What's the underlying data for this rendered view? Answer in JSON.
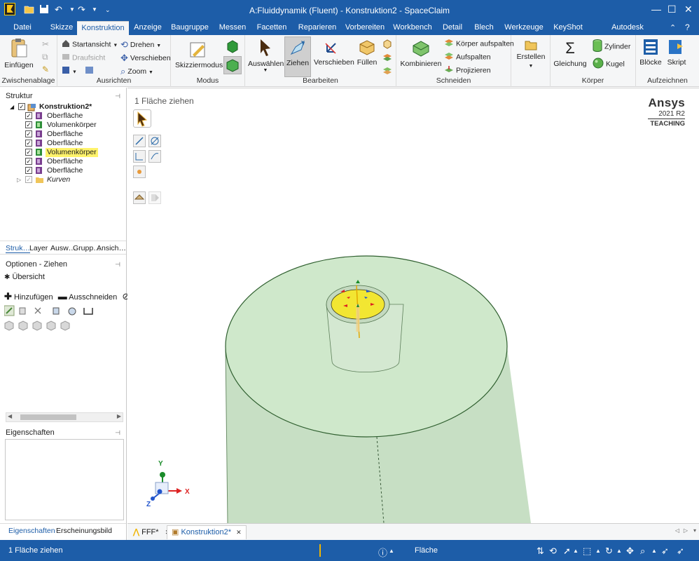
{
  "window": {
    "title": "A:Fluiddynamik (Fluent) - Konstruktion2 - SpaceClaim"
  },
  "quick_access": {
    "icons": [
      "app-logo-icon",
      "open-folder-icon",
      "save-icon",
      "undo-icon",
      "redo-icon",
      "customize-icon"
    ]
  },
  "tabs": [
    "Datei",
    "Skizze",
    "Konstruktion",
    "Anzeige",
    "Baugruppe",
    "Messen",
    "Facetten",
    "Reparieren",
    "Vorbereiten",
    "Workbench",
    "Detail",
    "Blech",
    "Werkzeuge",
    "KeyShot",
    "Autodesk Simulation"
  ],
  "active_tab": "Konstruktion",
  "ribbon": {
    "groups": {
      "zwischenablage": "Zwischenablage",
      "ausrichten": "Ausrichten",
      "modus": "Modus",
      "bearbeiten": "Bearbeiten",
      "schneiden": "Schneiden",
      "koerper": "Körper",
      "aufzeichnen": "Aufzeichnen"
    },
    "buttons": {
      "einfuegen": "Einfügen",
      "startansicht": "Startansicht",
      "draufsicht": "Draufsicht",
      "drehen": "Drehen",
      "verschieben_view": "Verschieben",
      "zoom": "Zoom",
      "skizziermodus": "Skizziermodus",
      "auswaehlen": "Auswählen",
      "ziehen": "Ziehen",
      "verschieben": "Verschieben",
      "fuellen": "Füllen",
      "kombinieren": "Kombinieren",
      "koerper_aufspalten": "Körper aufspalten",
      "aufspalten": "Aufspalten",
      "projizieren": "Projizieren",
      "erstellen": "Erstellen",
      "gleichung": "Gleichung",
      "zylinder": "Zylinder",
      "kugel": "Kugel",
      "bloecke": "Blöcke",
      "skript": "Skript"
    }
  },
  "structure": {
    "title": "Struktur",
    "root": "Konstruktion2*",
    "items": [
      {
        "label": "Oberfläche",
        "type": "surface"
      },
      {
        "label": "Volumenkörper",
        "type": "solid"
      },
      {
        "label": "Oberfläche",
        "type": "surface"
      },
      {
        "label": "Oberfläche",
        "type": "surface"
      },
      {
        "label": "Volumenkörper",
        "type": "solid",
        "highlighted": true
      },
      {
        "label": "Oberfläche",
        "type": "surface"
      },
      {
        "label": "Oberfläche",
        "type": "surface"
      }
    ],
    "curves": "Kurven",
    "tabs": [
      "Struk…",
      "Layer",
      "Ausw…",
      "Grupp…",
      "Ansich…"
    ]
  },
  "options": {
    "title": "Optionen - Ziehen",
    "overview": "Übersicht",
    "add": "Hinzufügen",
    "cut": "Ausschneiden"
  },
  "properties": {
    "title": "Eigenschaften",
    "tabs": [
      "Eigenschaften",
      "Erscheinungsbild"
    ]
  },
  "viewport": {
    "hint": "1 Fläche ziehen",
    "brand": "Ansys",
    "version": "2021 R2",
    "edition": "TEACHING",
    "axes": {
      "x": "X",
      "y": "Y",
      "z": "Z"
    },
    "colors": {
      "body": "#c9e2c6",
      "top": "#cfe8cb",
      "edge": "#2e6e2e",
      "selected": "#f2e632"
    }
  },
  "doc_tabs": [
    {
      "label": "FFF*"
    },
    {
      "label": "Konstruktion2*",
      "active": true
    }
  ],
  "statusbar": {
    "message": "1 Fläche ziehen",
    "selection_type": "Fläche"
  },
  "colors": {
    "accent": "#1d5da8",
    "ribbon_bg": "#f5f6f7",
    "highlight": "#fff36b"
  }
}
